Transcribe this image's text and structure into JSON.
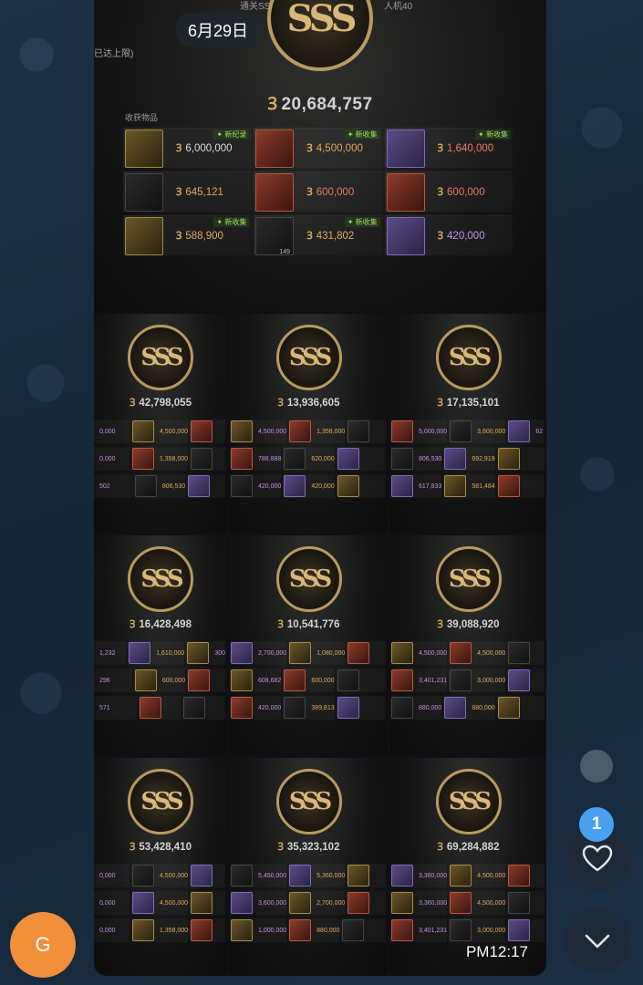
{
  "chat": {
    "date_pill": "6月29日",
    "avatar_letter": "G",
    "time": "PM12:17",
    "like_count": "1"
  },
  "main_card": {
    "header_left": "通关SSS",
    "header_right": "人机40",
    "note": "已达上限)",
    "badge_text": "SSS",
    "total": "20,684,757",
    "items_label": "收获物品",
    "coin_symbol": "Ꝫ",
    "rows": [
      [
        {
          "price": "6,000,000",
          "tag": "新纪录",
          "color": "white",
          "thumb": "gold"
        },
        {
          "price": "4,500,000",
          "tag": "新收集",
          "color": "gold",
          "thumb": "red"
        },
        {
          "price": "1,640,000",
          "tag": "新收集",
          "color": "red",
          "thumb": "purple"
        }
      ],
      [
        {
          "price": "645,121",
          "tag": "",
          "color": "gold",
          "thumb": "dark"
        },
        {
          "price": "600,000",
          "tag": "",
          "color": "red",
          "thumb": "red"
        },
        {
          "price": "600,000",
          "tag": "",
          "color": "red",
          "thumb": "red"
        }
      ],
      [
        {
          "price": "588,900",
          "tag": "新收集",
          "color": "gold",
          "thumb": "gold"
        },
        {
          "price": "431,802",
          "tag": "新收集",
          "color": "gold",
          "thumb": "dark",
          "stack": "149"
        },
        {
          "price": "420,000",
          "tag": "",
          "color": "purple",
          "thumb": "purple"
        }
      ]
    ]
  },
  "cards": [
    {
      "total": "42,798,055",
      "rows": [
        [
          "0,000",
          "4,500,000",
          ""
        ],
        [
          "0,000",
          "1,358,000",
          ""
        ],
        [
          "502",
          "806,530",
          ""
        ]
      ]
    },
    {
      "total": "13,936,605",
      "rows": [
        [
          "4,500,000",
          "1,358,000",
          ""
        ],
        [
          "788,888",
          "620,000",
          ""
        ],
        [
          "420,000",
          "420,000",
          ""
        ]
      ]
    },
    {
      "total": "17,135,101",
      "rows": [
        [
          "5,000,000",
          "3,600,000",
          "62"
        ],
        [
          "806,530",
          "692,919",
          ""
        ],
        [
          "617,833",
          "581,484",
          ""
        ]
      ]
    },
    {
      "total": "16,428,498",
      "rows": [
        [
          "1,232",
          "1,610,000",
          "300"
        ],
        [
          "296",
          "600,000",
          ""
        ],
        [
          "571",
          "",
          ""
        ]
      ]
    },
    {
      "total": "10,541,776",
      "rows": [
        [
          "2,700,000",
          "1,080,000",
          ""
        ],
        [
          "608,682",
          "600,000",
          ""
        ],
        [
          "420,000",
          "389,813",
          ""
        ]
      ]
    },
    {
      "total": "39,088,920",
      "rows": [
        [
          "4,500,000",
          "4,500,000",
          ""
        ],
        [
          "3,401,231",
          "3,000,000",
          ""
        ],
        [
          "880,000",
          "880,000",
          ""
        ]
      ]
    },
    {
      "total": "53,428,410",
      "rows": [
        [
          "0,000",
          "4,500,000",
          ""
        ],
        [
          "0,000",
          "4,500,000",
          ""
        ],
        [
          "0,000",
          "1,358,000",
          ""
        ]
      ]
    },
    {
      "total": "35,323,102",
      "rows": [
        [
          "5,450,000",
          "5,360,000",
          ""
        ],
        [
          "3,600,000",
          "2,700,000",
          ""
        ],
        [
          "1,000,000",
          "880,000",
          ""
        ]
      ]
    },
    {
      "total": "69,284,882",
      "rows": [
        [
          "3,360,000",
          "4,500,000",
          ""
        ],
        [
          "3,360,000",
          "4,500,000",
          ""
        ],
        [
          "3,401,231",
          "3,000,000",
          ""
        ]
      ]
    }
  ]
}
